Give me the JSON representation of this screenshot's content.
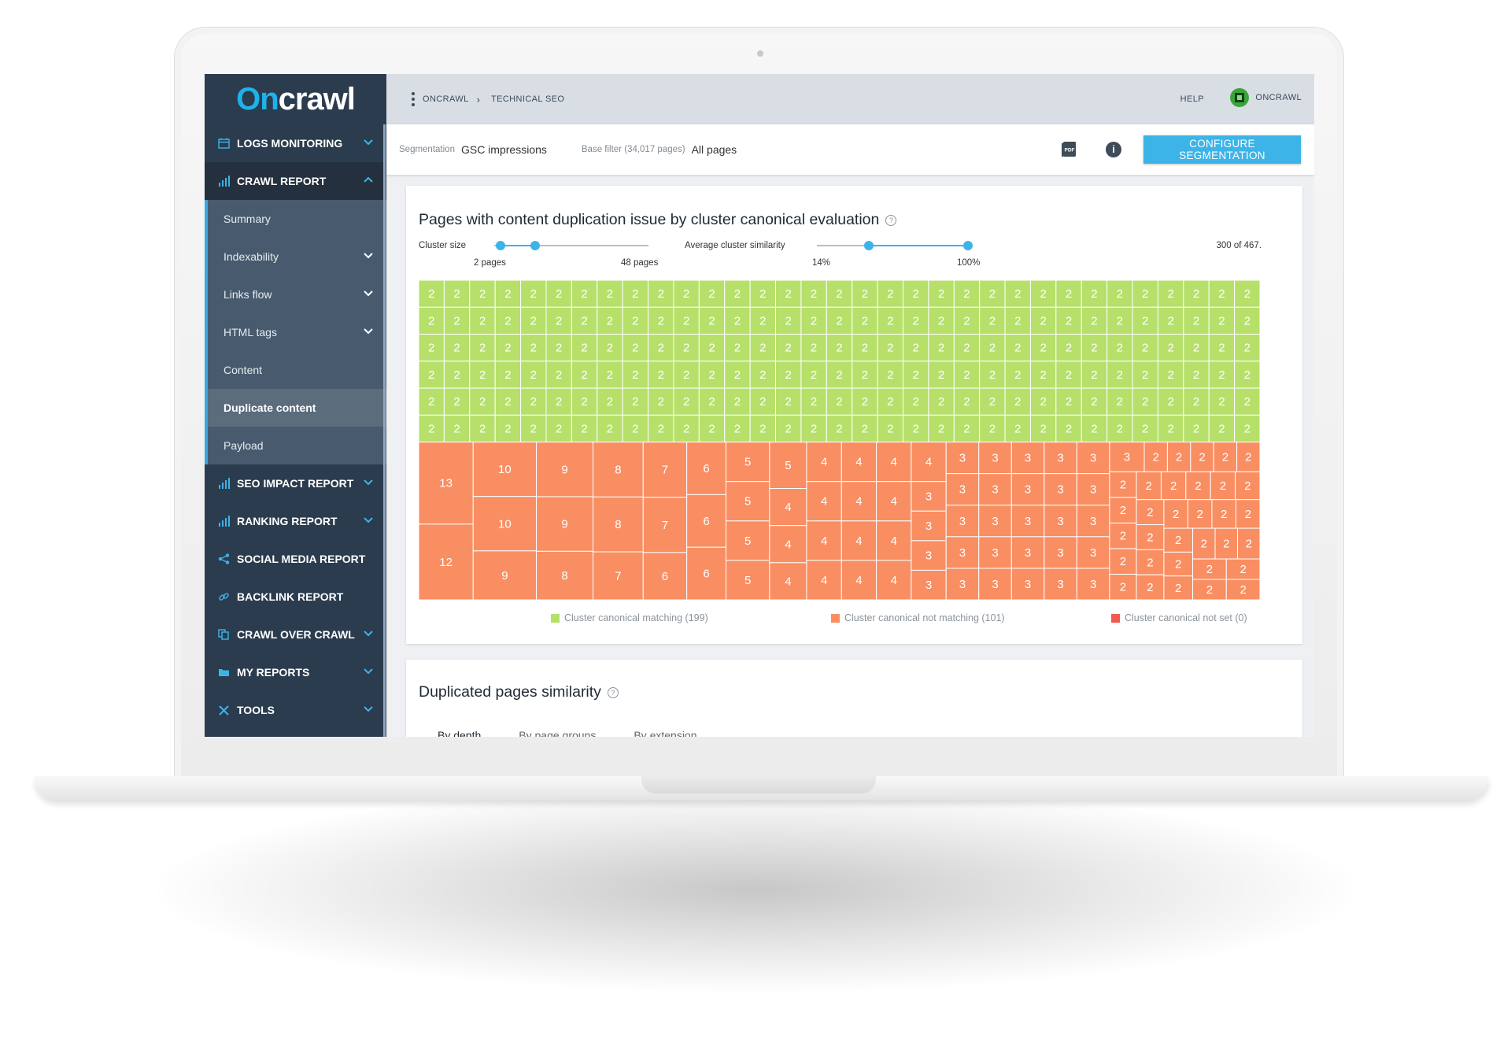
{
  "app": {
    "logo_main": "On",
    "logo_rest": "crawl"
  },
  "topbar": {
    "breadcrumb": [
      "ONCRAWL",
      "TECHNICAL SEO"
    ],
    "help_label": "HELP",
    "user_label": "ONCRAWL"
  },
  "sidebar": {
    "sections": [
      {
        "label": "LOGS MONITORING",
        "icon": "calendar-icon",
        "expanded": false
      },
      {
        "label": "CRAWL REPORT",
        "icon": "bar-chart-icon",
        "expanded": true
      },
      {
        "label": "SEO IMPACT REPORT",
        "icon": "bar-chart-icon",
        "expanded": false
      },
      {
        "label": "RANKING REPORT",
        "icon": "bar-chart-icon",
        "expanded": false
      },
      {
        "label": "SOCIAL MEDIA REPORT",
        "icon": "share-icon"
      },
      {
        "label": "BACKLINK REPORT",
        "icon": "link-icon"
      },
      {
        "label": "CRAWL OVER CRAWL",
        "icon": "copy-icon",
        "expanded": false
      },
      {
        "label": "MY REPORTS",
        "icon": "folder-icon",
        "expanded": false
      },
      {
        "label": "TOOLS",
        "icon": "tools-icon",
        "expanded": false
      }
    ],
    "crawl_report_items": [
      {
        "label": "Summary"
      },
      {
        "label": "Indexability",
        "has_children": true
      },
      {
        "label": "Links flow",
        "has_children": true
      },
      {
        "label": "HTML tags",
        "has_children": true
      },
      {
        "label": "Content"
      },
      {
        "label": "Duplicate content",
        "selected": true
      },
      {
        "label": "Payload"
      }
    ]
  },
  "filters": {
    "segmentation_label": "Segmentation",
    "segmentation_value": "GSC impressions",
    "base_filter_label": "Base filter (34,017 pages)",
    "base_filter_value": "All pages",
    "configure_button": "CONFIGURE SEGMENTATION",
    "pdf_icon": "pdf-icon",
    "info_icon": "info-icon"
  },
  "card1": {
    "title": "Pages with content duplication issue by cluster canonical evaluation",
    "cluster_size_label": "Cluster size",
    "cluster_size_min": "2 pages",
    "cluster_size_max": "48 pages",
    "similarity_label": "Average cluster similarity",
    "similarity_min": "14%",
    "similarity_max": "100%",
    "counter": "300 of 467."
  },
  "card2": {
    "title": "Duplicated pages similarity",
    "tabs": [
      "By depth",
      "By page groups",
      "By extension"
    ],
    "active_tab": "By depth"
  },
  "colors": {
    "matching": "#b6e06a",
    "not_matching": "#f98e62",
    "not_set": "#f25a50",
    "accent": "#3cb4e8",
    "sidebar_bg": "#2b3c4e"
  },
  "chart_data": {
    "type": "treemap",
    "title": "Pages with content duplication issue by cluster canonical evaluation",
    "legend": [
      {
        "label": "Cluster canonical matching (199)",
        "color": "#b6e06a"
      },
      {
        "label": "Cluster canonical not matching (101)",
        "color": "#f98e62"
      },
      {
        "label": "Cluster canonical not set (0)",
        "color": "#f25a50"
      }
    ],
    "categories": [
      {
        "name": "Cluster canonical matching",
        "count": 199,
        "cluster_sizes": [
          2,
          2,
          2,
          2,
          2,
          2,
          2,
          2,
          2,
          2,
          2,
          2,
          2,
          2,
          2,
          2,
          2,
          2,
          2,
          2,
          2,
          2,
          2,
          2,
          2,
          2,
          2,
          2,
          2,
          2,
          2,
          2,
          2,
          2,
          2,
          2,
          2,
          2,
          2,
          2,
          2,
          2,
          2,
          2,
          2,
          2,
          2,
          2,
          2,
          2,
          2,
          2,
          2,
          2,
          2,
          2,
          2,
          2,
          2,
          2,
          2,
          2,
          2,
          2,
          2,
          2,
          2,
          2,
          2,
          2,
          2,
          2,
          2,
          2,
          2,
          2,
          2,
          2,
          2,
          2,
          2,
          2,
          2,
          2,
          2,
          2,
          2,
          2,
          2,
          2,
          2,
          2,
          2,
          2,
          2,
          2,
          2,
          2,
          2,
          2,
          2,
          2,
          2,
          2,
          2,
          2,
          2,
          2,
          2,
          2,
          2,
          2,
          2,
          2,
          2,
          2,
          2,
          2,
          2,
          2,
          2,
          2,
          2,
          2,
          2,
          2,
          2,
          2,
          2,
          2,
          2,
          2,
          2,
          2,
          2,
          2,
          2,
          2,
          2,
          2,
          2,
          2,
          2,
          2,
          2,
          2,
          2,
          2,
          2,
          2,
          2,
          2,
          2,
          2,
          2,
          2,
          2,
          2,
          2,
          2,
          2,
          2,
          2,
          2,
          2,
          2,
          2,
          2,
          2,
          2,
          2,
          2,
          2,
          2,
          2,
          2,
          2,
          2,
          2,
          2,
          2,
          2,
          2,
          2,
          2,
          2,
          2,
          2,
          2,
          2,
          2,
          2,
          2,
          2,
          2,
          2,
          2,
          2
        ]
      },
      {
        "name": "Cluster canonical not matching",
        "count": 101,
        "cluster_sizes": [
          2,
          2,
          2,
          2,
          2,
          2,
          2,
          2,
          2,
          2,
          2,
          2,
          2,
          2,
          2,
          2,
          2,
          2,
          2,
          2,
          2,
          2,
          2,
          2,
          2,
          2,
          2,
          2,
          2,
          2,
          2,
          2,
          2,
          3,
          3,
          3,
          3,
          3,
          3,
          3,
          3,
          3,
          3,
          3,
          3,
          3,
          3,
          3,
          3,
          3,
          3,
          3,
          3,
          3,
          3,
          3,
          3,
          3,
          3,
          3,
          3,
          3,
          3,
          4,
          4,
          4,
          4,
          4,
          4,
          4,
          4,
          4,
          4,
          4,
          4,
          4,
          4,
          4,
          4,
          5,
          5,
          5,
          5,
          5,
          6,
          6,
          6,
          6,
          7,
          7,
          7,
          8,
          8,
          8,
          9,
          9,
          9,
          10,
          10,
          12,
          13
        ]
      },
      {
        "name": "Cluster canonical not set",
        "count": 0,
        "cluster_sizes": []
      }
    ]
  }
}
